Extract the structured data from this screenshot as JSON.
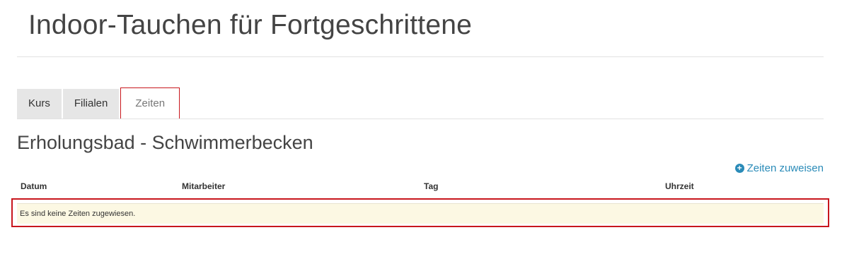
{
  "page": {
    "title": "Indoor-Tauchen für Fortgeschrittene"
  },
  "tabs": [
    {
      "label": "Kurs",
      "active": false
    },
    {
      "label": "Filialen",
      "active": false
    },
    {
      "label": "Zeiten",
      "active": true
    }
  ],
  "section": {
    "title": "Erholungsbad - Schwimmerbecken",
    "assign_link": {
      "label": "Zeiten zuweisen",
      "icon": "plus-circle-icon"
    }
  },
  "table": {
    "columns": [
      "Datum",
      "Mitarbeiter",
      "Tag",
      "Uhrzeit"
    ],
    "empty_message": "Es sind keine Zeiten zugewiesen."
  },
  "colors": {
    "accent_link": "#2a8bb8",
    "highlight_border": "#c8161d",
    "notice_bg": "#fcf8e3"
  }
}
